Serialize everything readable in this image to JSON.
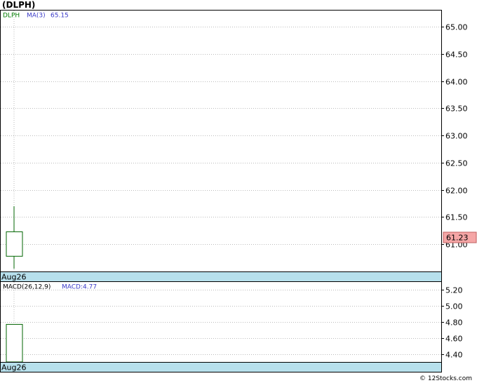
{
  "title": "(DLPH)",
  "footer": "© 12Stocks.com",
  "colors": {
    "date_band": "#b7e0ec",
    "price_candle": "#006400",
    "price_label_bg": "#f5a6a6",
    "legend_ticker": "#007a00",
    "legend_ma": "#3a3ac8",
    "grid": "#bbbbbb"
  },
  "chart_data": [
    {
      "type": "candlestick",
      "legend": {
        "ticker": "DLPH",
        "indicator": "MA(3)",
        "indicator_value": "65.15"
      },
      "x": [
        "Aug26"
      ],
      "date_label": "Aug26",
      "candles": [
        {
          "date": "Aug26",
          "open": 61.23,
          "close": 60.78,
          "high": 61.7,
          "low": 60.55
        }
      ],
      "current_price_label": "61.23",
      "ylim": [
        60.5,
        65.3
      ],
      "y_ticks": [
        65.0,
        64.5,
        64.0,
        63.5,
        63.0,
        62.5,
        62.0,
        61.5,
        61.0
      ],
      "y_tick_labels": [
        "65.00",
        "64.50",
        "64.00",
        "63.50",
        "63.00",
        "62.50",
        "62.00",
        "61.50",
        "61.00"
      ],
      "grid": true
    },
    {
      "type": "bar",
      "legend": {
        "indicator": "MACD(26,12,9)",
        "indicator_value": "MACD:4.77"
      },
      "x": [
        "Aug26"
      ],
      "date_label": "Aug26",
      "values": [
        4.77
      ],
      "ylim": [
        4.3,
        5.3
      ],
      "y_ticks": [
        5.2,
        5.0,
        4.8,
        4.6,
        4.4
      ],
      "y_tick_labels": [
        "5.20",
        "5.00",
        "4.80",
        "4.60",
        "4.40"
      ],
      "grid": true
    }
  ]
}
